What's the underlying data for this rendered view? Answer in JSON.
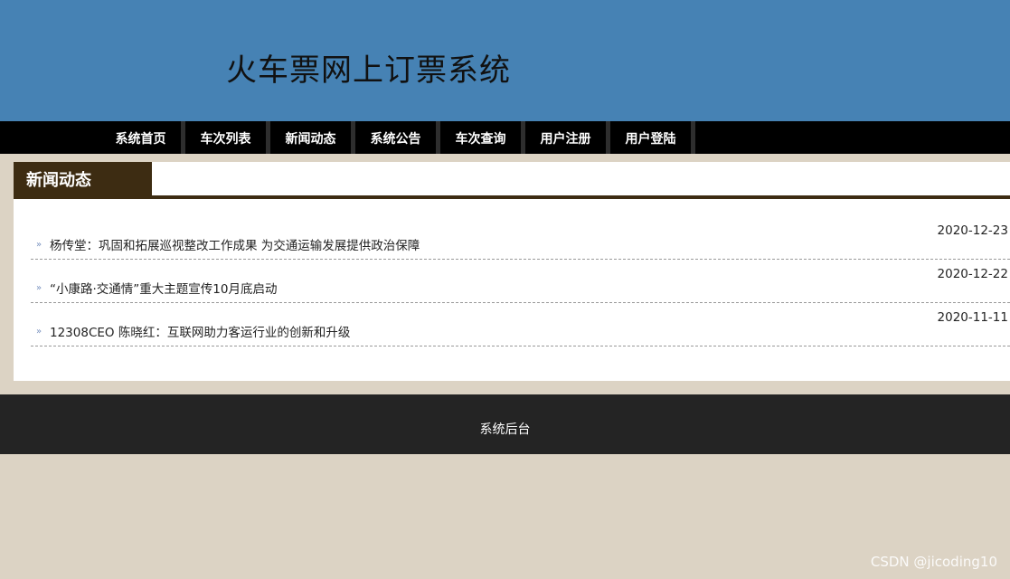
{
  "header": {
    "title": "火车票网上订票系统"
  },
  "nav": {
    "items": [
      {
        "label": "系统首页"
      },
      {
        "label": "车次列表"
      },
      {
        "label": "新闻动态"
      },
      {
        "label": "系统公告"
      },
      {
        "label": "车次查询"
      },
      {
        "label": "用户注册"
      },
      {
        "label": "用户登陆"
      }
    ]
  },
  "panel": {
    "title": "新闻动态"
  },
  "news": [
    {
      "title": "杨传堂：巩固和拓展巡视整改工作成果 为交通运输发展提供政治保障",
      "date": "2020-12-23"
    },
    {
      "title": "“小康路·交通情”重大主题宣传10月底启动",
      "date": "2020-12-22"
    },
    {
      "title": "12308CEO 陈晓红：互联网助力客运行业的创新和升级",
      "date": "2020-11-11"
    }
  ],
  "footer": {
    "link": "系统后台"
  },
  "watermark": "CSDN @jicoding10",
  "colors": {
    "header_bg": "#4682b4",
    "nav_bg": "#000000",
    "tab_bg": "#3d2c12",
    "page_bg": "#dcd3c4",
    "footer_bg": "#242424"
  }
}
